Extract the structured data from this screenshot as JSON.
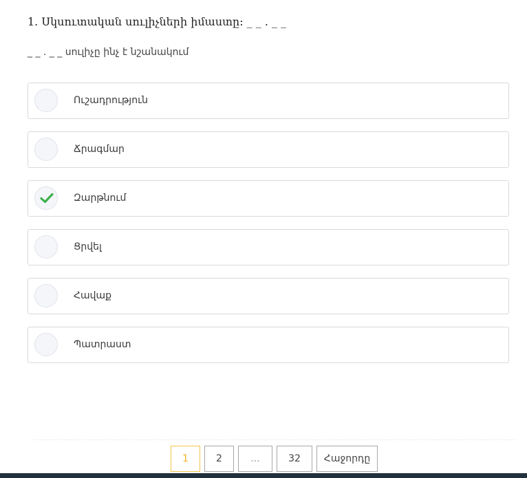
{
  "question": {
    "title": "1. Սկսուտական սուլիչների իմաստը: _ _ . _ _",
    "subtitle": "_ _ . _ _ սուլիչը ինչ է նշանակում"
  },
  "options": [
    {
      "label": "Ուշադրություն",
      "selected": false
    },
    {
      "label": "Ճրագմար",
      "selected": false
    },
    {
      "label": "Զարթնում",
      "selected": true
    },
    {
      "label": "Ցրվել",
      "selected": false
    },
    {
      "label": "Հավաք",
      "selected": false
    },
    {
      "label": "Պատրաստ",
      "selected": false
    }
  ],
  "pagination": {
    "current": "1",
    "page2": "2",
    "ellipsis": "...",
    "last": "32",
    "next": "Հաջորդը"
  },
  "colors": {
    "check": "#3cb14a",
    "active_page": "#f2b01e",
    "footer": "#21313d"
  }
}
